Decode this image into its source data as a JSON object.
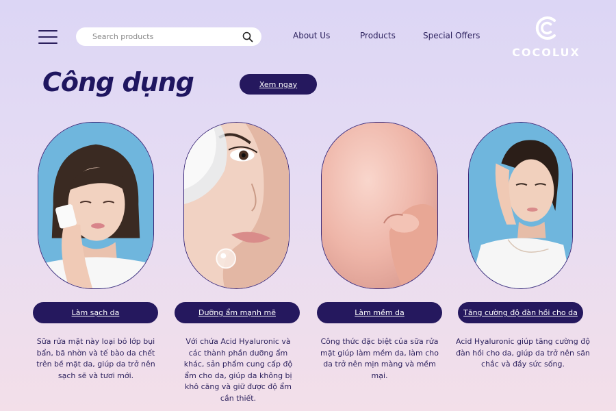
{
  "header": {
    "menu_icon": "hamburger-menu-icon",
    "search": {
      "placeholder": "Search products",
      "value": "",
      "icon": "search-icon"
    },
    "nav": [
      {
        "label": "About Us"
      },
      {
        "label": "Products"
      },
      {
        "label": "Special Offers"
      }
    ],
    "logo": {
      "text": "COCOLUX",
      "icon": "cocolux-logo-mark"
    }
  },
  "main": {
    "title": "Công dụng",
    "cta_label": "Xem ngay",
    "cards": [
      {
        "image": "woman-cleansing-face-with-cotton-pad",
        "button_label": "Làm sạch da",
        "description": "Sữa rửa mặt này loại bỏ lớp bụi bẩn, bã nhờn và tế bào da chết trên bề mặt da, giúp da trở nên sạch sẽ và tươi mới."
      },
      {
        "image": "close-up-face-with-serum-droplet",
        "button_label": "Dưỡng ẩm mạnh mẽ",
        "description": "Với chứa Acid Hyaluronic và các thành phần dưỡng ẩm khác, sản phẩm cung cấp độ ẩm cho da, giúp da không bị khô căng và giữ được độ ẩm cần thiết."
      },
      {
        "image": "finger-pressing-smooth-skin",
        "button_label": "Làm mềm da",
        "description": "Công thức đặc biệt của sữa rửa mặt giúp làm mềm da, làm cho da trở nên mịn màng và mềm mại."
      },
      {
        "image": "woman-applying-cream-to-cheek",
        "button_label": "Tăng cường độ đàn hồi cho da",
        "description": "Acid Hyaluronic giúp tăng cường độ đàn hồi cho da, giúp da trở nên săn chắc và đầy sức sống."
      }
    ]
  },
  "colors": {
    "primary": "#25185e",
    "title": "#1f1660",
    "text": "#2a1f5c",
    "background_top": "#dcd6f5",
    "background_bottom": "#f3dfe9",
    "photo_sky": "#6fb6dd",
    "logo": "#ffffff"
  }
}
